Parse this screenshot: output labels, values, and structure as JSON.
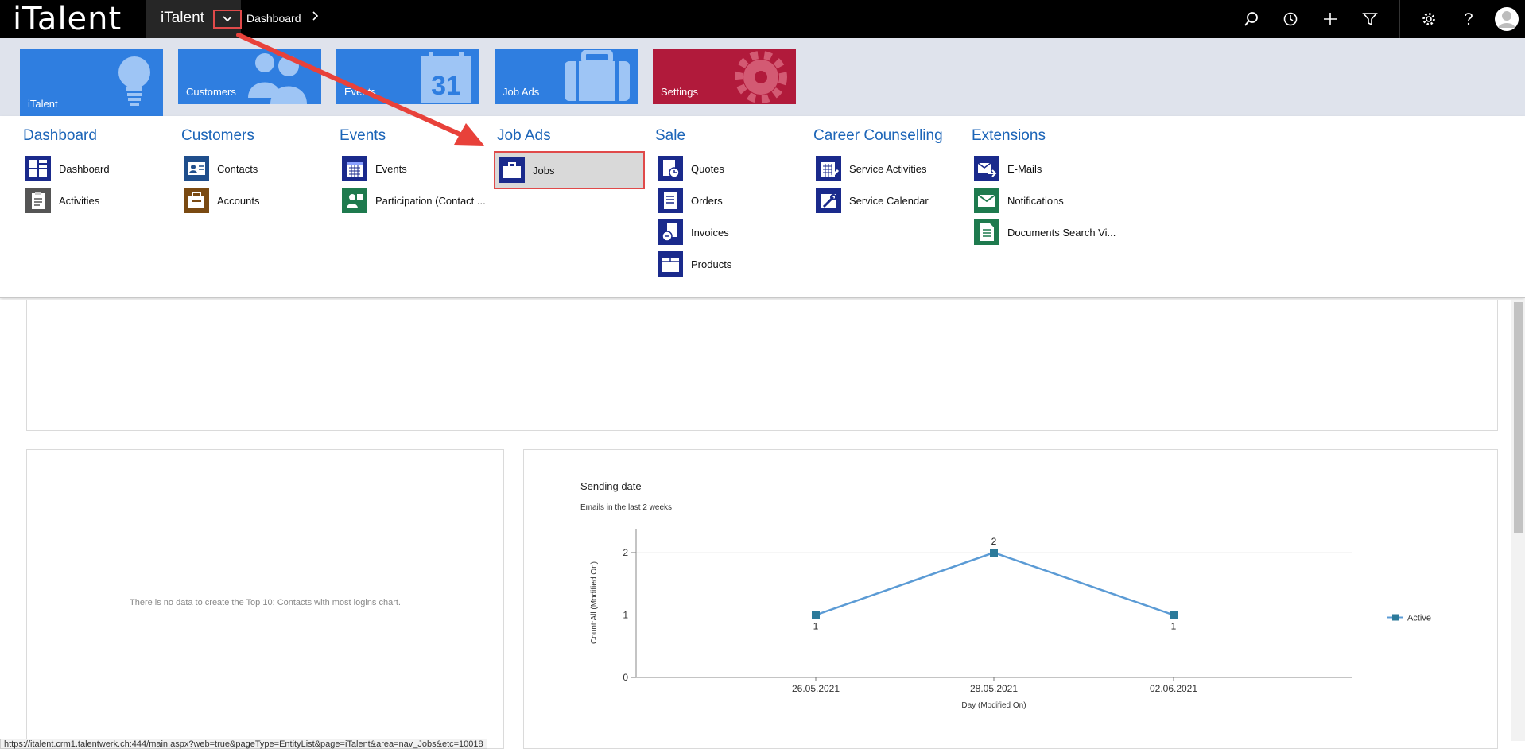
{
  "topbar": {
    "logo": "iTalent",
    "app_name": "iTalent",
    "breadcrumb": "Dashboard",
    "icons": [
      "search-icon",
      "history-icon",
      "plus-icon",
      "filter-icon",
      "gear-icon",
      "help-icon",
      "user-avatar-icon"
    ]
  },
  "tiles": [
    {
      "label": "iTalent",
      "icon": "lightbulb-icon",
      "color": "#2f7ee0"
    },
    {
      "label": "Customers",
      "icon": "people-icon",
      "color": "#2f7ee0"
    },
    {
      "label": "Events",
      "icon": "calendar-31-icon",
      "color": "#2f7ee0"
    },
    {
      "label": "Job Ads",
      "icon": "briefcase-icon",
      "color": "#2f7ee0"
    },
    {
      "label": "Settings",
      "icon": "gear-icon",
      "color": "#b11a3b"
    }
  ],
  "tile_events_calendar_day": "31",
  "nav": {
    "dashboard": {
      "title": "Dashboard",
      "items": [
        "Dashboard",
        "Activities"
      ]
    },
    "customers": {
      "title": "Customers",
      "items": [
        "Contacts",
        "Accounts"
      ]
    },
    "events": {
      "title": "Events",
      "items": [
        "Events",
        "Participation (Contact ..."
      ]
    },
    "jobads": {
      "title": "Job Ads",
      "items": [
        "Jobs"
      ]
    },
    "sale": {
      "title": "Sale",
      "items": [
        "Quotes",
        "Orders",
        "Invoices",
        "Products"
      ]
    },
    "career": {
      "title": "Career Counselling",
      "items": [
        "Service Activities",
        "Service Calendar"
      ]
    },
    "extensions": {
      "title": "Extensions",
      "items": [
        "E-Mails",
        "Notifications",
        "Documents Search Vi..."
      ]
    }
  },
  "cards": {
    "nodata_message": "There is no data to create the Top 10: Contacts with most logins chart."
  },
  "chart_data": {
    "type": "line",
    "title": "Sending date",
    "subtitle": "Emails in the last 2 weeks",
    "xlabel": "Day (Modified On)",
    "ylabel": "Count:All (Modified On)",
    "categories": [
      "26.05.2021",
      "28.05.2021",
      "02.06.2021"
    ],
    "series": [
      {
        "name": "Active",
        "values": [
          1,
          2,
          1
        ],
        "color": "#5b9bd5"
      }
    ],
    "ylim": [
      0,
      2
    ],
    "yticks": [
      "0",
      "1",
      "2"
    ],
    "data_labels": [
      "1",
      "2",
      "1"
    ],
    "legend": "right",
    "grid": true
  },
  "statusbar": {
    "url": "https://italent.crm1.talentwerk.ch:444/main.aspx?web=true&pageType=EntityList&page=iTalent&area=nav_Jobs&etc=10018"
  }
}
